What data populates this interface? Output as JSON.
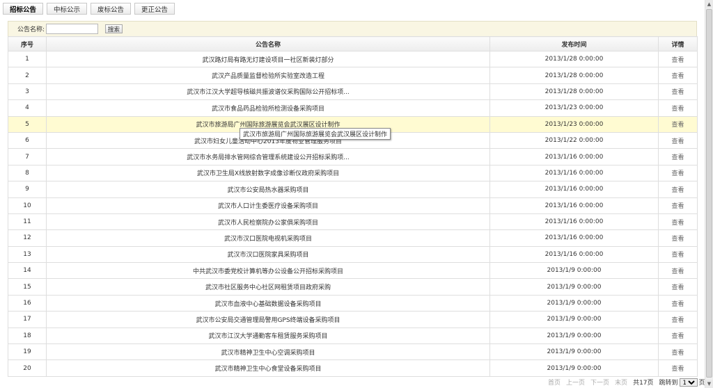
{
  "tabs": [
    {
      "label": "招标公告",
      "active": true
    },
    {
      "label": "中标公示",
      "active": false
    },
    {
      "label": "废标公告",
      "active": false
    },
    {
      "label": "更正公告",
      "active": false
    }
  ],
  "search": {
    "label": "公告名称:",
    "value": "",
    "button": "搜索"
  },
  "table": {
    "headers": [
      "序号",
      "公告名称",
      "发布时间",
      "详情"
    ],
    "rows": [
      {
        "seq": "1",
        "name": "武汉路灯局有路无灯建设项目一社区新装灯部分",
        "time": "2013/1/28 0:00:00",
        "detail": "查看"
      },
      {
        "seq": "2",
        "name": "武汉产品质量监督检验所实验室改造工程",
        "time": "2013/1/28 0:00:00",
        "detail": "查看"
      },
      {
        "seq": "3",
        "name": "武汉市江汉大学超导核磁共振波谱仪采购国际公开招标项...",
        "time": "2013/1/28 0:00:00",
        "detail": "查看"
      },
      {
        "seq": "4",
        "name": "武汉市食品药品检验所检测设备采购项目",
        "time": "2013/1/23 0:00:00",
        "detail": "查看"
      },
      {
        "seq": "5",
        "name": "武汉市旅游局广州国际旅游展览会武汉展区设计制作",
        "time": "2013/1/23 0:00:00",
        "detail": "查看"
      },
      {
        "seq": "6",
        "name": "武汉市妇女儿童活动中心2013年度物业管理服务项目",
        "time": "2013/1/22 0:00:00",
        "detail": "查看"
      },
      {
        "seq": "7",
        "name": "武汉市水务局排水管网综合管理系统建设公开招标采购项...",
        "time": "2013/1/16 0:00:00",
        "detail": "查看"
      },
      {
        "seq": "8",
        "name": "武汉市卫生局X线放射数字成像诊断仪政府采购项目",
        "time": "2013/1/16 0:00:00",
        "detail": "查看"
      },
      {
        "seq": "9",
        "name": "武汉市公安局热水器采购项目",
        "time": "2013/1/16 0:00:00",
        "detail": "查看"
      },
      {
        "seq": "10",
        "name": "武汉市人口计生委医疗设备采购项目",
        "time": "2013/1/16 0:00:00",
        "detail": "查看"
      },
      {
        "seq": "11",
        "name": "武汉市人民检察院办公家俱采购项目",
        "time": "2013/1/16 0:00:00",
        "detail": "查看"
      },
      {
        "seq": "12",
        "name": "武汉市汉口医院电视机采购项目",
        "time": "2013/1/16 0:00:00",
        "detail": "查看"
      },
      {
        "seq": "13",
        "name": "武汉市汉口医院家具采购项目",
        "time": "2013/1/16 0:00:00",
        "detail": "查看"
      },
      {
        "seq": "14",
        "name": "中共武汉市委党校计算机等办公设备公开招标采购项目",
        "time": "2013/1/9 0:00:00",
        "detail": "查看"
      },
      {
        "seq": "15",
        "name": "武汉市社区服务中心社区网租赁项目政府采购",
        "time": "2013/1/9 0:00:00",
        "detail": "查看"
      },
      {
        "seq": "16",
        "name": "武汉市血液中心基础数据设备采购项目",
        "time": "2013/1/9 0:00:00",
        "detail": "查看"
      },
      {
        "seq": "17",
        "name": "武汉市公安局交通管理局警用GPS终端设备采购项目",
        "time": "2013/1/9 0:00:00",
        "detail": "查看"
      },
      {
        "seq": "18",
        "name": "武汉市江汉大学通勤客车租赁服务采购项目",
        "time": "2013/1/9 0:00:00",
        "detail": "查看"
      },
      {
        "seq": "19",
        "name": "武汉市精神卫生中心空调采购项目",
        "time": "2013/1/9 0:00:00",
        "detail": "查看"
      },
      {
        "seq": "20",
        "name": "武汉市精神卫生中心食堂设备采购项目",
        "time": "2013/1/9 0:00:00",
        "detail": "查看"
      }
    ]
  },
  "highlighted_row": "5",
  "tooltip": "武汉市旅游局广州国际旅游展览会武汉展区设计制作",
  "pager": {
    "first": "首页",
    "prev": "上一页",
    "next": "下一页",
    "last": "末页",
    "total": "共17页",
    "jump_label": "跳转到",
    "jump_value": "1",
    "page_unit": "页"
  },
  "colors": {
    "highlight_row": "#fffbd2",
    "search_bar": "#f9f6e3",
    "border": "#dedede"
  }
}
